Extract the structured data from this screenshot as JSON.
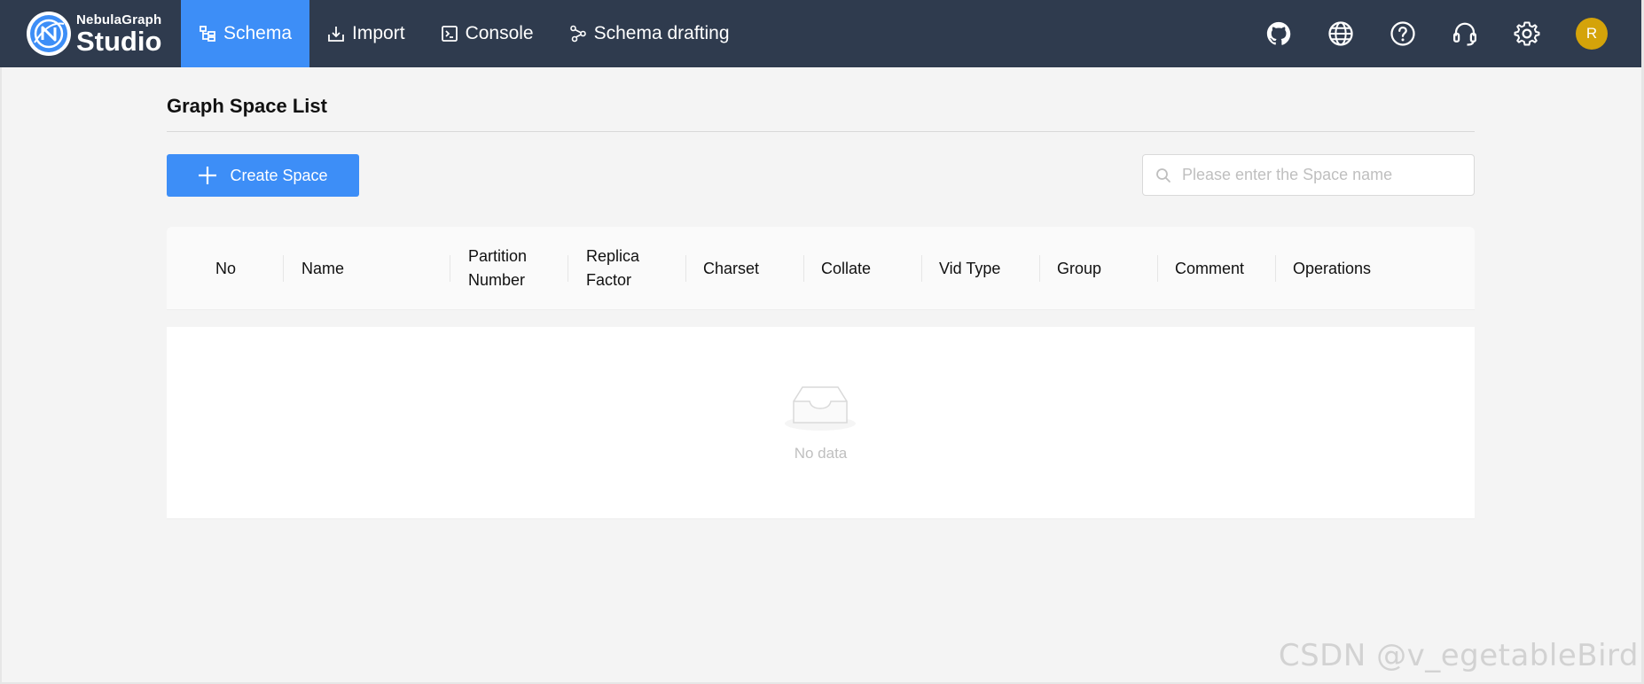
{
  "app": {
    "brand_line1": "NebulaGraph",
    "brand_line2": "Studio"
  },
  "nav": [
    {
      "label": "Schema",
      "icon": "schema-tree-icon",
      "active": true
    },
    {
      "label": "Import",
      "icon": "import-icon",
      "active": false
    },
    {
      "label": "Console",
      "icon": "console-icon",
      "active": false
    },
    {
      "label": "Schema drafting",
      "icon": "schema-drafting-icon",
      "active": false
    }
  ],
  "tools": [
    {
      "icon": "github-icon"
    },
    {
      "icon": "globe-icon"
    },
    {
      "icon": "help-icon"
    },
    {
      "icon": "headset-icon"
    },
    {
      "icon": "gear-icon"
    }
  ],
  "user": {
    "avatar_initial": "R",
    "avatar_color": "#d4a30a"
  },
  "page": {
    "title": "Graph Space List"
  },
  "toolbar": {
    "create_label": "Create Space"
  },
  "search": {
    "placeholder": "Please enter the Space name",
    "value": ""
  },
  "table": {
    "columns": [
      {
        "line1": "No",
        "line2": ""
      },
      {
        "line1": "Name",
        "line2": ""
      },
      {
        "line1": "Partition",
        "line2": "Number"
      },
      {
        "line1": "Replica",
        "line2": "Factor"
      },
      {
        "line1": "Charset",
        "line2": ""
      },
      {
        "line1": "Collate",
        "line2": ""
      },
      {
        "line1": "Vid Type",
        "line2": ""
      },
      {
        "line1": "Group",
        "line2": ""
      },
      {
        "line1": "Comment",
        "line2": ""
      },
      {
        "line1": "Operations",
        "line2": ""
      }
    ],
    "rows": [],
    "empty_text": "No data"
  },
  "watermark": "CSDN @v_egetableBird",
  "colors": {
    "header_bg": "#2f3b4e",
    "accent": "#3d8ef7",
    "page_bg": "#f4f4f4"
  }
}
